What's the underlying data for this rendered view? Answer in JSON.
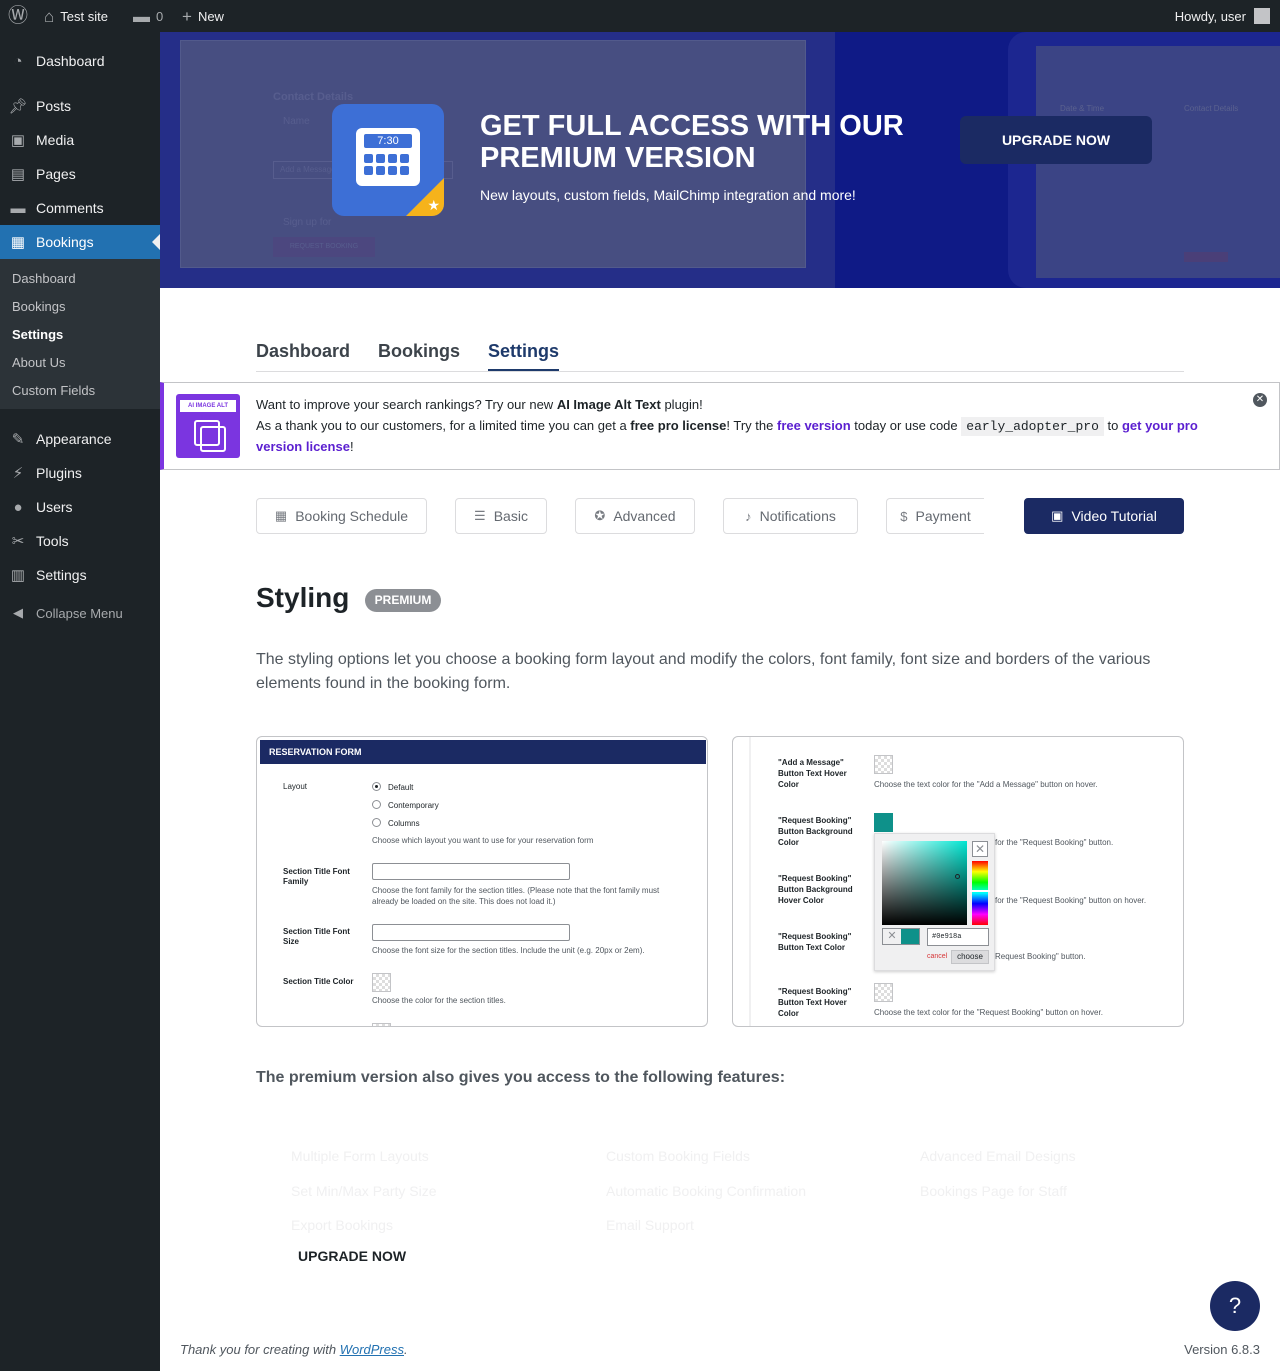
{
  "admin_bar": {
    "site_name": "Test site",
    "comments_count": "0",
    "new_label": "New",
    "howdy": "Howdy, user"
  },
  "sidebar": {
    "items": [
      {
        "label": "Dashboard",
        "icon": "dashboard-icon"
      },
      {
        "label": "Posts",
        "icon": "pushpin-icon"
      },
      {
        "label": "Media",
        "icon": "media-icon"
      },
      {
        "label": "Pages",
        "icon": "pages-icon"
      },
      {
        "label": "Comments",
        "icon": "comments-icon"
      },
      {
        "label": "Bookings",
        "icon": "calendar-icon"
      },
      {
        "label": "Appearance",
        "icon": "paintbrush-icon"
      },
      {
        "label": "Plugins",
        "icon": "plug-icon"
      },
      {
        "label": "Users",
        "icon": "users-icon"
      },
      {
        "label": "Tools",
        "icon": "wrench-icon"
      },
      {
        "label": "Settings",
        "icon": "settings-icon"
      }
    ],
    "submenu": [
      "Dashboard",
      "Bookings",
      "Settings",
      "About Us",
      "Custom Fields"
    ],
    "collapse": "Collapse Menu"
  },
  "banner": {
    "title": "GET FULL ACCESS WITH OUR PREMIUM VERSION",
    "subtitle": "New layouts, custom fields, MailChimp integration and more!",
    "button": "UPGRADE NOW",
    "icon_time": "7:30",
    "mock_contact": "Contact Details",
    "mock_name": "Name",
    "mock_add": "Add a Message",
    "mock_signup": "Sign up for",
    "mock_request": "REQUEST BOOKING",
    "mock_date": "Date & Time",
    "mock_contact2": "Contact Details"
  },
  "tabs": [
    "Dashboard",
    "Bookings",
    "Settings"
  ],
  "notice": {
    "logo_text": "AI IMAGE ALT TEXT",
    "line1_a": "Want to improve your search rankings? Try our new ",
    "line1_b": "AI Image Alt Text",
    "line1_c": " plugin!",
    "line2_a": "As a thank you to our customers, for a limited time you can get a ",
    "line2_b": "free pro license",
    "line2_c": "! Try the ",
    "line2_link1": "free version",
    "line2_d": " today or use code ",
    "code": "early_adopter_pro",
    "line2_e": " to ",
    "line2_link2": "get your pro version license",
    "line2_f": "!"
  },
  "settings_tabs": [
    {
      "label": "Booking Schedule",
      "icon": "calendar-icon"
    },
    {
      "label": "Basic",
      "icon": "lines-icon"
    },
    {
      "label": "Advanced",
      "icon": "award-icon"
    },
    {
      "label": "Notifications",
      "icon": "bell-icon"
    },
    {
      "label": "Payment",
      "icon": "dollar-icon"
    },
    {
      "label": "Video Tutorial",
      "icon": "video-icon"
    }
  ],
  "styling": {
    "title": "Styling",
    "badge": "PREMIUM",
    "description": "The styling options let you choose a booking form layout and modify the colors, font family, font size and borders of the various elements found in the booking form."
  },
  "shot1": {
    "header": "RESERVATION FORM",
    "layout": "Layout",
    "opt_default": "Default",
    "opt_contemporary": "Contemporary",
    "opt_columns": "Columns",
    "layout_help": "Choose which layout you want to use for your reservation form",
    "font_family": "Section Title Font Family",
    "font_family_help": "Choose the font family for the section titles. (Please note that the font family must already be loaded on the site. This does not load it.)",
    "font_size": "Section Title Font Size",
    "font_size_help": "Choose the font size for the section titles. Include the unit (e.g. 20px or 2em).",
    "color": "Section Title Color",
    "color_help": "Choose the color for the section titles."
  },
  "shot2": {
    "r1_label": "\"Add a Message\" Button Text Hover Color",
    "r1_help": "Choose the text color for the \"Add a Message\" button on hover.",
    "r2_label": "\"Request Booking\" Button Background Color",
    "r2_help": "for the \"Request Booking\" button.",
    "r3_label": "\"Request Booking\" Button Background Hover Color",
    "r3_help": "for the \"Request Booking\" button on hover.",
    "r4_label": "\"Request Booking\" Button Text Color",
    "r4_help": "Request Booking\" button.",
    "r5_label": "\"Request Booking\" Button Text Hover Color",
    "r5_help": "Choose the text color for the \"Request Booking\" button on hover.",
    "hex": "#0e918a",
    "cancel": "cancel",
    "choose": "choose",
    "swatch_color": "#0e918a"
  },
  "features": {
    "heading": "The premium version also gives you access to the following features:",
    "items": [
      "Multiple Form Layouts",
      "Custom Booking Fields",
      "Advanced Email Designs",
      "Set Min/Max Party Size",
      "Automatic Booking Confirmation",
      "Bookings Page for Staff",
      "Export Bookings",
      "Email Support"
    ],
    "button": "UPGRADE NOW"
  },
  "help_button": "?",
  "footer": {
    "thanks_a": "Thank you for creating with ",
    "thanks_link": "WordPress",
    "thanks_b": ".",
    "version": "Version 6.8.3"
  },
  "colors": {
    "accent": "#2271b1",
    "brand": "#1b2a63",
    "notice": "#7b35e0"
  }
}
